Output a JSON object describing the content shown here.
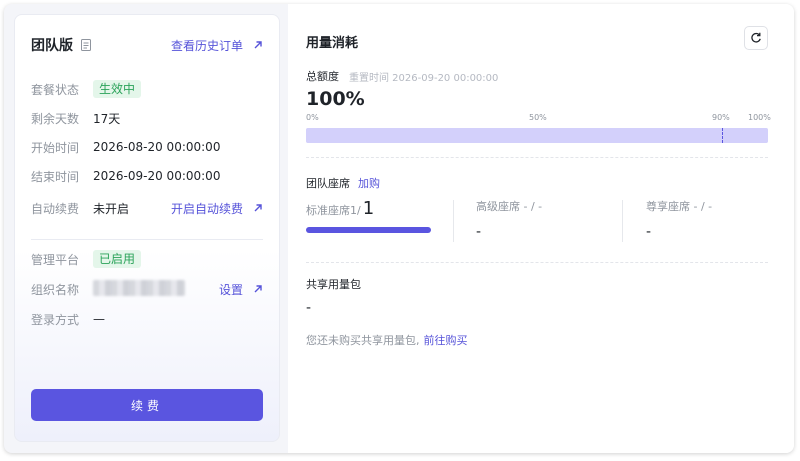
{
  "plan": {
    "title": "团队版",
    "history_link": "查看历史订单",
    "status_label": "套餐状态",
    "status_value": "生效中",
    "remaining_label": "剩余天数",
    "remaining_value": "17天",
    "start_label": "开始时间",
    "start_value": "2026-08-20 00:00:00",
    "end_label": "结束时间",
    "end_value": "2026-09-20 00:00:00",
    "autorenew_label": "自动续费",
    "autorenew_value": "未开启",
    "autorenew_link": "开启自动续费",
    "platform_label": "管理平台",
    "platform_value": "已启用",
    "org_label": "组织名称",
    "org_settings_link": "设置",
    "login_label": "登录方式",
    "login_value": "—",
    "renew_button": "续费"
  },
  "usage": {
    "title": "用量消耗",
    "total_label": "总额度",
    "reset_time": "重置时间 2026-09-20 00:00:00",
    "percent_text": "100%",
    "percent_value": 100,
    "ticks": [
      "0%",
      "50%",
      "90%",
      "100%"
    ],
    "threshold_value": 90,
    "seats_title": "团队座席",
    "buy_seats_link": "加购",
    "seats": {
      "standard_label": "标准座席1/",
      "standard_total": "1",
      "standard_fraction": 1,
      "advanced_label": "高级座席 - / -",
      "advanced_value": "-",
      "premium_label": "尊享座席 - / -",
      "premium_value": "-"
    },
    "pack_title": "共享用量包",
    "pack_value": "-",
    "pack_note": "您还未购买共享用量包,",
    "pack_link": "前往购买"
  },
  "colors": {
    "accent": "#5a55e0",
    "success_text": "#2ba35a",
    "success_bg": "#e4f6ea"
  }
}
